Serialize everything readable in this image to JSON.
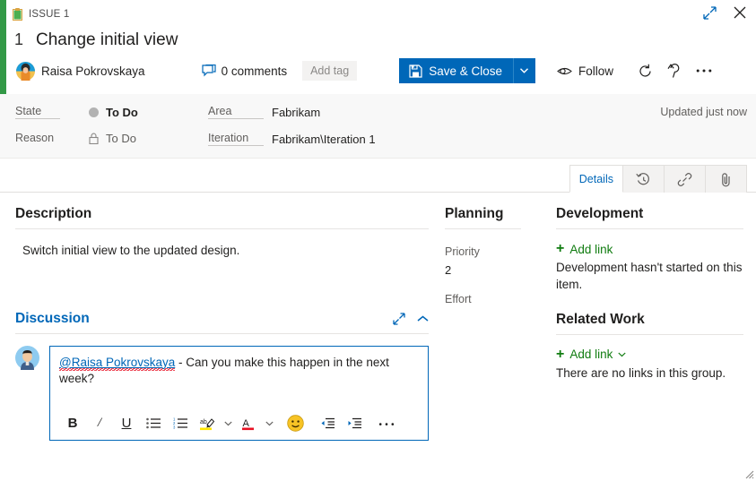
{
  "window": {
    "type_color": "#339947",
    "accent_color": "#0067b8",
    "success_color": "#107c10",
    "breadcrumb": "ISSUE 1",
    "breadcrumb_icon": "issue-clipboard-icon",
    "expand_icon": "expand-diagonal-icon",
    "close_icon": "close-icon"
  },
  "header": {
    "work_item_id": "1",
    "title": "Change initial view",
    "assignee": "Raisa Pokrovskaya",
    "comments_label": "0 comments",
    "add_tag_label": "Add tag",
    "save_label": "Save & Close",
    "save_icon": "save-disk-icon",
    "save_caret_icon": "chevron-down-icon",
    "follow_label": "Follow",
    "follow_icon": "follow-eye-icon",
    "refresh_icon": "refresh-icon",
    "revert_icon": "revert-undo-icon",
    "more_icon": "more-ellipsis-icon"
  },
  "fields": {
    "state": {
      "label": "State",
      "value": "To Do",
      "dot_color": "#b2b2b2"
    },
    "reason": {
      "label": "Reason",
      "value": "To Do",
      "icon": "lock-icon"
    },
    "area": {
      "label": "Area",
      "value": "Fabrikam"
    },
    "iteration": {
      "label": "Iteration",
      "value": "Fabrikam\\Iteration 1"
    },
    "updated": "Updated just now"
  },
  "tabs": [
    {
      "label": "Details",
      "name": "tab-details",
      "icon": "",
      "active": true
    },
    {
      "label": "",
      "name": "tab-history",
      "icon": "history-clock-icon",
      "active": false
    },
    {
      "label": "",
      "name": "tab-links",
      "icon": "link-chain-icon",
      "active": false
    },
    {
      "label": "",
      "name": "tab-attachments",
      "icon": "paperclip-icon",
      "active": false
    }
  ],
  "description": {
    "heading": "Description",
    "text": "Switch initial view to the updated design."
  },
  "discussion": {
    "heading": "Discussion",
    "expand_icon": "expand-diagonal-icon",
    "collapse_icon": "chevron-up-icon",
    "comment_mention": "@Raisa Pokrovskaya",
    "comment_rest": " - Can you make this happen in the next week?",
    "toolbar": [
      {
        "name": "bold-button",
        "label": "B"
      },
      {
        "name": "italic-button",
        "label": "/"
      },
      {
        "name": "underline-button",
        "label": "U"
      },
      {
        "name": "bullet-list-button",
        "label": ""
      },
      {
        "name": "numbered-list-button",
        "label": ""
      },
      {
        "name": "highlight-color-button",
        "label": ""
      },
      {
        "name": "font-color-button",
        "label": ""
      },
      {
        "name": "emoji-button",
        "label": ""
      },
      {
        "name": "outdent-button",
        "label": ""
      },
      {
        "name": "indent-button",
        "label": ""
      },
      {
        "name": "more-formatting-button",
        "label": ""
      }
    ]
  },
  "planning": {
    "heading": "Planning",
    "priority_label": "Priority",
    "priority_value": "2",
    "effort_label": "Effort",
    "effort_value": ""
  },
  "development": {
    "heading": "Development",
    "add_link_label": "Add link",
    "empty_text": "Development hasn't started on this item."
  },
  "related_work": {
    "heading": "Related Work",
    "add_link_label": "Add link",
    "empty_text": "There are no links in this group."
  }
}
